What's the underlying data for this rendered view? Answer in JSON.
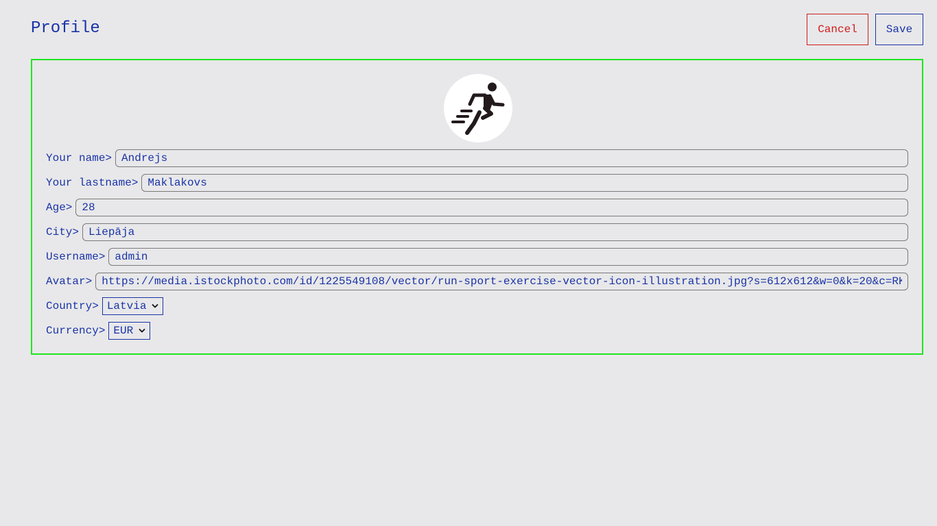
{
  "header": {
    "title": "Profile",
    "cancel_label": "Cancel",
    "save_label": "Save"
  },
  "avatar": {
    "icon": "runner-icon",
    "alt": "avatar"
  },
  "form": {
    "name": {
      "label": "Your name>",
      "value": "Andrejs"
    },
    "lastname": {
      "label": "Your lastname>",
      "value": "Maklakovs"
    },
    "age": {
      "label": "Age>",
      "value": "28"
    },
    "city": {
      "label": "City>",
      "value": "Liepāja"
    },
    "username": {
      "label": "Username>",
      "value": "admin"
    },
    "avatar_url": {
      "label": "Avatar>",
      "value": "https://media.istockphoto.com/id/1225549108/vector/run-sport-exercise-vector-icon-illustration.jpg?s=612x612&w=0&k=20&c=RK"
    },
    "country": {
      "label": "Country>",
      "selected": "Latvia"
    },
    "currency": {
      "label": "Currency>",
      "selected": "EUR"
    }
  },
  "colors": {
    "accent": "#1a33a6",
    "cancel": "#d11a1a",
    "panel_border": "#1ee61e",
    "background": "#e8e8ea"
  }
}
